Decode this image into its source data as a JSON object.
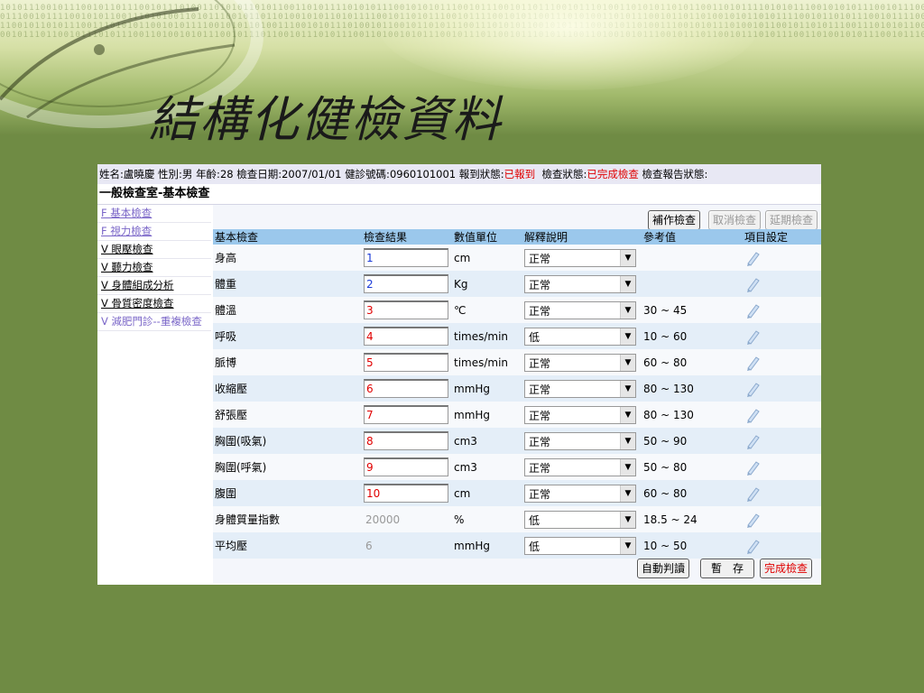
{
  "slide": {
    "title": "結構化健檢資料"
  },
  "patient_bar": {
    "name_label": "姓名:",
    "name": "盧曉慶",
    "sex_label": "性別:",
    "sex": "男",
    "age_label": "年齡:",
    "age": "28",
    "date_label": "檢查日期:",
    "date": "2007/01/01",
    "id_label": "健診號碼:",
    "id": "0960101001",
    "report_in_label": "報到狀態:",
    "report_in": "已報到",
    "exam_status_label": "檢查狀態:",
    "exam_status": "已完成檢查",
    "report_status_label": "檢查報告狀態:"
  },
  "section_title": "一般檢查室-基本檢查",
  "nav": [
    {
      "label": "F 基本檢查"
    },
    {
      "label": "F 視力檢查"
    },
    {
      "label": "V 眼壓檢查"
    },
    {
      "label": "V 聽力檢查"
    },
    {
      "label": "V 身體組成分析"
    },
    {
      "label": "V 骨質密度檢查"
    },
    {
      "label": "V 減肥門診--重複檢查"
    }
  ],
  "buttons": {
    "supplement": "補作檢查",
    "cancel": "取消檢查",
    "postpone": "延期檢查",
    "auto_judge": "自動判讀",
    "save_draft": "暫　存",
    "complete": "完成檢查"
  },
  "table": {
    "headers": [
      "基本檢查",
      "檢查結果",
      "數值單位",
      "解釋說明",
      "參考值",
      "項目設定"
    ],
    "rows": [
      {
        "name": "身高",
        "result": "1",
        "unit": "cm",
        "interp": "正常",
        "ref": ""
      },
      {
        "name": "體重",
        "result": "2",
        "unit": "Kg",
        "interp": "正常",
        "ref": ""
      },
      {
        "name": "體溫",
        "result": "3",
        "unit": "℃",
        "interp": "正常",
        "ref": "30 ~ 45"
      },
      {
        "name": "呼吸",
        "result": "4",
        "unit": "times/min",
        "interp": "低",
        "ref": "10 ~ 60"
      },
      {
        "name": "脈博",
        "result": "5",
        "unit": "times/min",
        "interp": "正常",
        "ref": "60 ~ 80"
      },
      {
        "name": "收縮壓",
        "result": "6",
        "unit": "mmHg",
        "interp": "正常",
        "ref": "80 ~ 130"
      },
      {
        "name": "舒張壓",
        "result": "7",
        "unit": "mmHg",
        "interp": "正常",
        "ref": "80 ~ 130"
      },
      {
        "name": "胸圍(吸氣)",
        "result": "8",
        "unit": "cm3",
        "interp": "正常",
        "ref": "50 ~ 90"
      },
      {
        "name": "胸圍(呼氣)",
        "result": "9",
        "unit": "cm3",
        "interp": "正常",
        "ref": "50 ~ 80"
      },
      {
        "name": "腹圍",
        "result": "10",
        "unit": "cm",
        "interp": "正常",
        "ref": "60 ~ 80"
      },
      {
        "name": "身體質量指數",
        "result": "20000",
        "unit": "%",
        "interp": "低",
        "ref": "18.5 ~ 24"
      },
      {
        "name": "平均壓",
        "result": "6",
        "unit": "mmHg",
        "interp": "低",
        "ref": "10 ~ 50"
      }
    ]
  },
  "colors": {
    "background": "#6f8b44",
    "header_row": "#9bc8ec",
    "alert": "#e00000"
  }
}
